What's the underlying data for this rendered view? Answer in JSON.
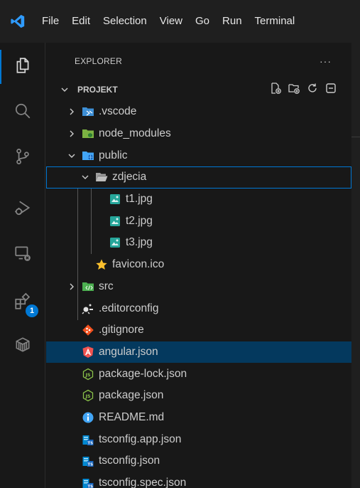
{
  "menu": [
    "File",
    "Edit",
    "Selection",
    "View",
    "Go",
    "Run",
    "Terminal"
  ],
  "explorer": {
    "title": "EXPLORER",
    "more": "···"
  },
  "project": {
    "name": "PROJEKT"
  },
  "activity_badge": "1",
  "tree": [
    {
      "name": ".vscode",
      "icon": "vscode-folder-icon",
      "depth": 0,
      "type": "folder-collapsed"
    },
    {
      "name": "node_modules",
      "icon": "node-modules-folder-icon",
      "depth": 0,
      "type": "folder-collapsed"
    },
    {
      "name": "public",
      "icon": "public-folder-icon",
      "depth": 0,
      "type": "folder-expanded"
    },
    {
      "name": "zdjecia",
      "icon": "folder-open-icon",
      "depth": 1,
      "type": "folder-expanded",
      "focused": true
    },
    {
      "name": "t1.jpg",
      "icon": "image-file-icon",
      "depth": 2,
      "type": "file"
    },
    {
      "name": "t2.jpg",
      "icon": "image-file-icon",
      "depth": 2,
      "type": "file"
    },
    {
      "name": "t3.jpg",
      "icon": "image-file-icon",
      "depth": 2,
      "type": "file"
    },
    {
      "name": "favicon.ico",
      "icon": "star-icon",
      "depth": 1,
      "type": "file"
    },
    {
      "name": "src",
      "icon": "src-folder-icon",
      "depth": 0,
      "type": "folder-collapsed"
    },
    {
      "name": ".editorconfig",
      "icon": "editorconfig-icon",
      "depth": 0,
      "type": "file"
    },
    {
      "name": ".gitignore",
      "icon": "git-icon",
      "depth": 0,
      "type": "file"
    },
    {
      "name": "angular.json",
      "icon": "angular-icon",
      "depth": 0,
      "type": "file",
      "selected": true
    },
    {
      "name": "package-lock.json",
      "icon": "nodejs-icon",
      "depth": 0,
      "type": "file"
    },
    {
      "name": "package.json",
      "icon": "nodejs-icon",
      "depth": 0,
      "type": "file"
    },
    {
      "name": "README.md",
      "icon": "info-icon",
      "depth": 0,
      "type": "file"
    },
    {
      "name": "tsconfig.app.json",
      "icon": "tsconfig-icon",
      "depth": 0,
      "type": "file"
    },
    {
      "name": "tsconfig.json",
      "icon": "tsconfig-icon",
      "depth": 0,
      "type": "file"
    },
    {
      "name": "tsconfig.spec.json",
      "icon": "tsconfig-icon",
      "depth": 0,
      "type": "file"
    }
  ],
  "colors": {
    "accent": "#0078d4",
    "selection": "#04395e",
    "background": "#181818",
    "titlebar": "#1f1f1f"
  }
}
